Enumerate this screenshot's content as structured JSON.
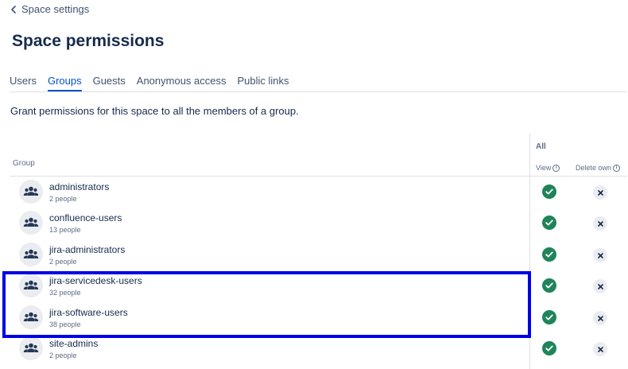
{
  "header": {
    "back_label": "Space settings",
    "title": "Space permissions"
  },
  "tabs": [
    {
      "label": "Users",
      "active": false
    },
    {
      "label": "Groups",
      "active": true
    },
    {
      "label": "Guests",
      "active": false
    },
    {
      "label": "Anonymous access",
      "active": false
    },
    {
      "label": "Public links",
      "active": false
    }
  ],
  "description": "Grant permissions for this space to all the members of a group.",
  "table": {
    "group_header": "Group",
    "section_header": "All",
    "permission_headers": [
      "View",
      "Delete own"
    ],
    "rows": [
      {
        "name": "administrators",
        "count": "2 people",
        "view": true,
        "delete_own": false
      },
      {
        "name": "confluence-users",
        "count": "13 people",
        "view": true,
        "delete_own": false
      },
      {
        "name": "jira-administrators",
        "count": "2 people",
        "view": true,
        "delete_own": false
      },
      {
        "name": "jira-servicedesk-users",
        "count": "32 people",
        "view": true,
        "delete_own": false
      },
      {
        "name": "jira-software-users",
        "count": "38 people",
        "view": true,
        "delete_own": false
      },
      {
        "name": "site-admins",
        "count": "2 people",
        "view": true,
        "delete_own": false
      }
    ]
  },
  "colors": {
    "accent": "#0052cc",
    "granted": "#1f845a",
    "highlight": "#0000e6"
  },
  "icons": {
    "back": "chevron-left-icon",
    "avatar": "people-group-icon",
    "granted": "check-circle-icon",
    "denied": "cross-circle-icon",
    "info": "info-icon"
  }
}
